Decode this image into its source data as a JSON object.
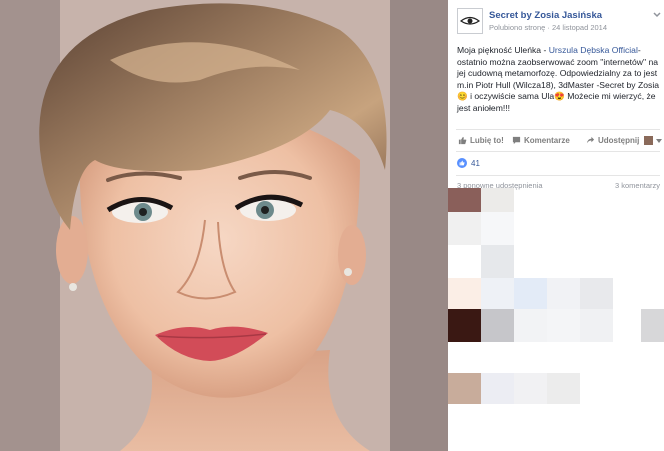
{
  "post": {
    "page_name": "Secret by Zosia Jasińska",
    "liked_label": "Polubiono stronę",
    "date": "24 listopad 2014",
    "text_part1": "Moja piękność Uleńka - ",
    "mention": "Urszula Dębska Official",
    "text_part2": "-ostatnio można zaobserwować zoom \"internetów\" na jej cudowną metamorfozę. Odpowiedzialny za to jest m.in Piotr Hull (Wilcza18), 3dMaster -Secret by Zosia",
    "emoji_1": "😊",
    "text_part3": " i oczywiście sama Ula",
    "emoji_2": "😍",
    "text_part4": " Możecie mi wierzyć, że jest aniołem!!!"
  },
  "actions": {
    "like": "Lubię to!",
    "comment": "Komentarze",
    "share": "Udostępnij"
  },
  "stats": {
    "likes_count": "41",
    "shares": "3 ponowne udostępnienia",
    "comments": "3 komentarzy"
  },
  "colors": {
    "link": "#365899",
    "text": "#1d2129",
    "meta": "#90949c",
    "like_blue": "#5890ff"
  },
  "icons": {
    "like": "thumbs-up-icon",
    "comment": "comment-icon",
    "share": "share-icon",
    "menu": "chevron-down-icon"
  }
}
